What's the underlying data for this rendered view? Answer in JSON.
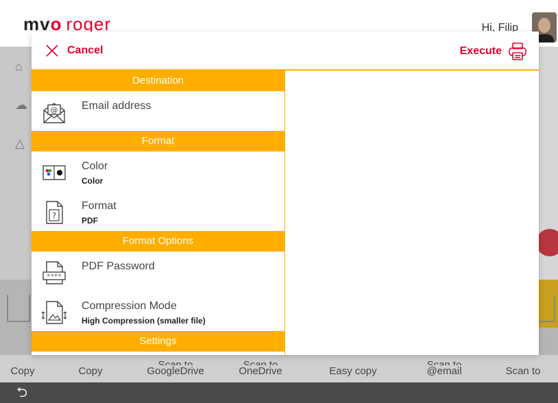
{
  "app": {
    "logo_main": "mv",
    "logo_o": "o",
    "logo_sub": "roger",
    "greeting": "Hi, Filip"
  },
  "dialog": {
    "cancel_label": "Cancel",
    "execute_label": "Execute",
    "sections": {
      "destination": "Destination",
      "format": "Format",
      "format_options": "Format Options",
      "settings": "Settings"
    },
    "items": {
      "email": {
        "label": "Email address"
      },
      "color": {
        "label": "Color",
        "value": "Color"
      },
      "format": {
        "label": "Format",
        "value": "PDF"
      },
      "pdf_password": {
        "label": "PDF Password"
      },
      "compression": {
        "label": "Compression Mode",
        "value": "High Compression (smaller file)"
      }
    }
  },
  "shortcuts": [
    {
      "line1": "",
      "line2": "Copy"
    },
    {
      "line1": "",
      "line2": "Copy"
    },
    {
      "line1": "Scan to",
      "line2": "GoogleDrive"
    },
    {
      "line1": "Scan to",
      "line2": "OneDrive"
    },
    {
      "line1": "",
      "line2": "Easy copy"
    },
    {
      "line1": "Scan to",
      "line2": "@email"
    },
    {
      "line1": "",
      "line2": "Scan to"
    }
  ],
  "colors": {
    "accent": "#e4002b",
    "section": "#ffae00"
  },
  "icons": {
    "cancel": "close-icon",
    "execute": "printer-icon",
    "email": "email-icon",
    "color": "color-mode-icon",
    "format": "file-format-icon",
    "pdf_password": "password-icon",
    "compression": "compression-icon",
    "back": "back-arrow-icon"
  }
}
